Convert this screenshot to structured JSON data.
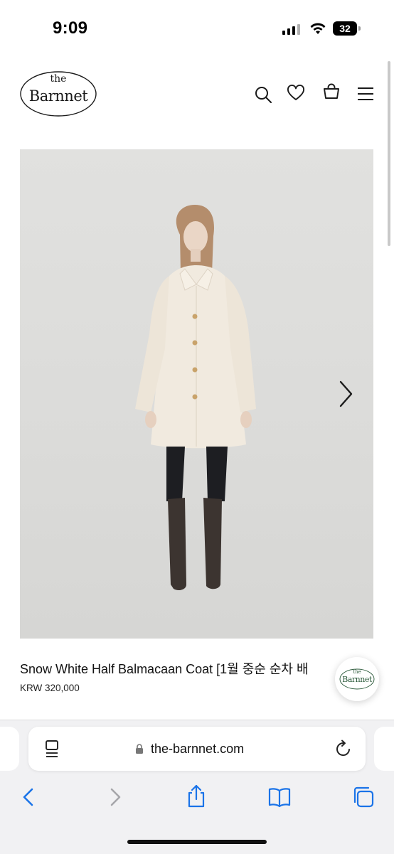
{
  "status_bar": {
    "time": "9:09",
    "battery_level": "32"
  },
  "header": {
    "logo_top": "the",
    "logo_main": "Barnnet"
  },
  "product": {
    "title": "Snow White Half Balmacaan Coat [1월 중순 순차 배",
    "price": "KRW 320,000"
  },
  "floating_badge": {
    "logo_top": "the",
    "logo_main": "Barnnet"
  },
  "browser": {
    "url": "the-barnnet.com"
  },
  "colors": {
    "accent_blue": "#1a73e8",
    "badge_green": "#2e5c3d"
  },
  "icons": {
    "header": [
      "search-icon",
      "heart-icon",
      "bag-icon",
      "menu-icon"
    ],
    "toolbar": [
      "back-icon",
      "forward-icon",
      "share-icon",
      "bookmarks-icon",
      "tabs-icon"
    ]
  }
}
